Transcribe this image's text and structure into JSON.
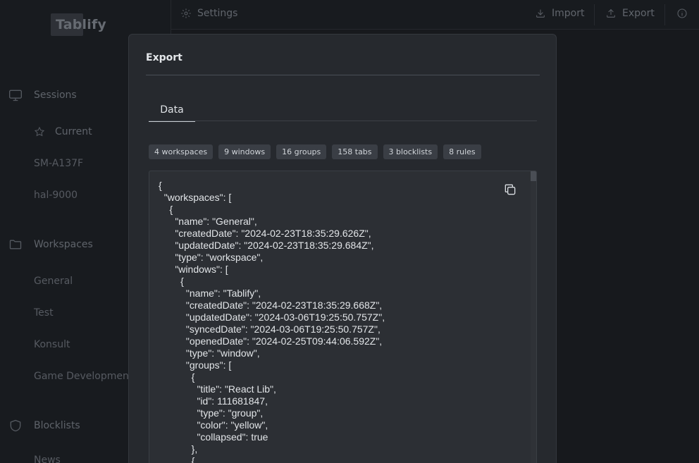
{
  "app": {
    "name": "Tablify"
  },
  "topbar": {
    "settings": "Settings",
    "import": "Import",
    "export": "Export"
  },
  "sidebar": {
    "sessions_title": "Sessions",
    "sessions": [
      "Current",
      "SM-A137F",
      "hal-9000"
    ],
    "workspaces_title": "Workspaces",
    "workspaces": [
      "General",
      "Test",
      "Konsult",
      "Game Development"
    ],
    "blocklists_title": "Blocklists",
    "blocklists": [
      "News"
    ]
  },
  "modal": {
    "title": "Export",
    "tab": "Data",
    "badges": [
      "4 workspaces",
      "9 windows",
      "16 groups",
      "158 tabs",
      "3 blocklists",
      "8 rules"
    ],
    "code": "{\n  \"workspaces\": [\n    {\n      \"name\": \"General\",\n      \"createdDate\": \"2024-02-23T18:35:29.626Z\",\n      \"updatedDate\": \"2024-02-23T18:35:29.684Z\",\n      \"type\": \"workspace\",\n      \"windows\": [\n        {\n          \"name\": \"Tablify\",\n          \"createdDate\": \"2024-02-23T18:35:29.668Z\",\n          \"updatedDate\": \"2024-03-06T19:25:50.757Z\",\n          \"syncedDate\": \"2024-03-06T19:25:50.757Z\",\n          \"openedDate\": \"2024-02-25T09:44:06.592Z\",\n          \"type\": \"window\",\n          \"groups\": [\n            {\n              \"title\": \"React Lib\",\n              \"id\": 111681847,\n              \"type\": \"group\",\n              \"color\": \"yellow\",\n              \"collapsed\": true\n            },\n            {"
  }
}
